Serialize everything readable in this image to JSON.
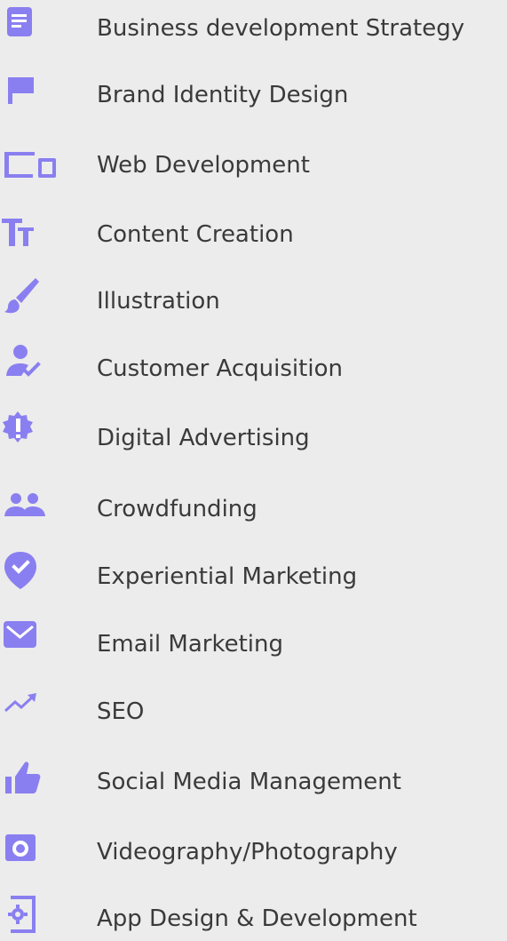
{
  "accent_color": "#8a7ff0",
  "text_color": "#3a3a3a",
  "background_color": "#ececec",
  "services": [
    {
      "label": "Business development Strategy",
      "icon": "document-icon"
    },
    {
      "label": "Brand Identity Design",
      "icon": "flag-icon"
    },
    {
      "label": "Web Development",
      "icon": "devices-icon"
    },
    {
      "label": "Content Creation",
      "icon": "text-size-icon"
    },
    {
      "label": "Illustration",
      "icon": "brush-icon"
    },
    {
      "label": "Customer Acquisition",
      "icon": "user-check-icon"
    },
    {
      "label": "Digital Advertising",
      "icon": "alert-badge-icon"
    },
    {
      "label": "Crowdfunding",
      "icon": "people-icon"
    },
    {
      "label": "Experiential Marketing",
      "icon": "location-check-icon"
    },
    {
      "label": "Email Marketing",
      "icon": "mail-icon"
    },
    {
      "label": "SEO",
      "icon": "trending-up-icon"
    },
    {
      "label": "Social Media Management",
      "icon": "thumbs-up-icon"
    },
    {
      "label": "Videography/Photography",
      "icon": "camera-icon"
    },
    {
      "label": "App Design & Development",
      "icon": "app-settings-icon"
    }
  ]
}
